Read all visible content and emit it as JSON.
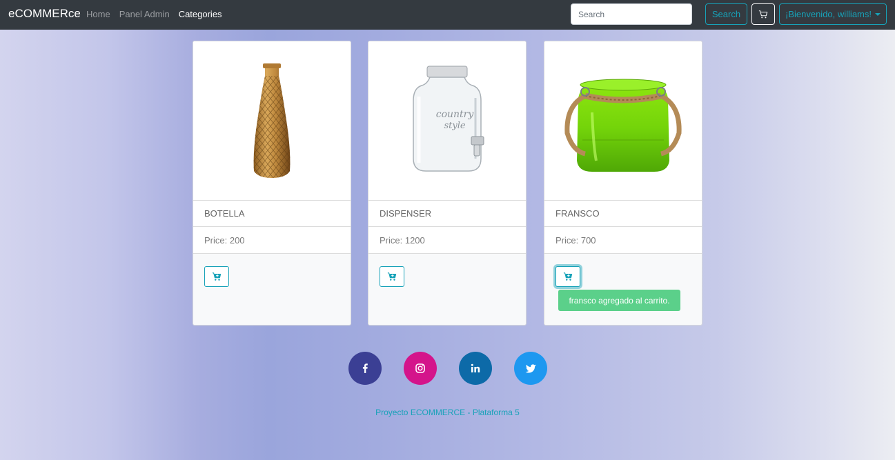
{
  "navbar": {
    "brand": "eCOMMERce",
    "links": [
      "Home",
      "Panel Admin",
      "Categories"
    ],
    "search_placeholder": "Search",
    "search_button": "Search",
    "user_menu": "¡Bienvenido, williams!"
  },
  "products": [
    {
      "name": "BOTELLA",
      "price": "Price: 200"
    },
    {
      "name": "DISPENSER",
      "price": "Price: 1200"
    },
    {
      "name": "FRANSCO",
      "price": "Price: 700"
    }
  ],
  "toast": "fransco agregado al carrito.",
  "social": [
    "facebook-icon",
    "instagram-icon",
    "linkedin-icon",
    "twitter-icon"
  ],
  "footer": "Proyecto ECOMMERCE - Plataforma 5",
  "colors": {
    "navbar": "#343a40",
    "accent": "#17a2b8",
    "toast": "#5bd08a",
    "facebook": "#3b3f94",
    "instagram": "#d4148b",
    "linkedin": "#0d6aa8",
    "twitter": "#1d98f0"
  }
}
